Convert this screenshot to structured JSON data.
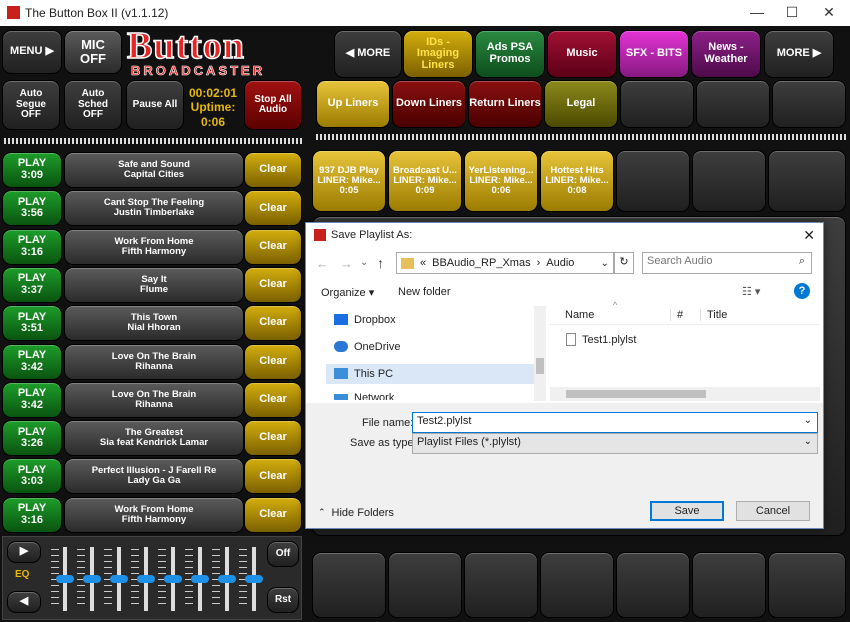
{
  "window": {
    "title": "The Button Box II (v1.1.12)",
    "minimize": "—",
    "maximize": "☐",
    "close": "✕"
  },
  "left_top": {
    "menu": "MENU ▶",
    "mic_line1": "MIC",
    "mic_line2": "OFF",
    "logo_line1": "Button",
    "logo_line2": "BROADCASTER",
    "auto_segue_1": "Auto",
    "auto_segue_2": "Segue",
    "auto_segue_3": "OFF",
    "auto_sched_1": "Auto",
    "auto_sched_2": "Sched",
    "auto_sched_3": "OFF",
    "pause_all": "Pause All",
    "timer": "00:02:01",
    "uptime_label": "Uptime:",
    "uptime": "0:06",
    "stop_all_1": "Stop All",
    "stop_all_2": "Audio"
  },
  "category_bar": {
    "more_left": "◀ MORE",
    "ids_1": "IDs -",
    "ids_2": "Imaging",
    "ids_3": "Liners",
    "ads_1": "Ads  PSA",
    "ads_2": "Promos",
    "music": "Music",
    "sfx": "SFX - BITS",
    "news_1": "News -",
    "news_2": "Weather",
    "more_right": "MORE ▶"
  },
  "sub_tabs": {
    "up": "Up Liners",
    "down": "Down Liners",
    "return": "Return Liners",
    "legal": "Legal"
  },
  "liners": [
    {
      "l1": "937 DJB Play",
      "l2": "LINER: Mike...",
      "l3": "0:05"
    },
    {
      "l1": "Broadcast U...",
      "l2": "LINER: Mike...",
      "l3": "0:09"
    },
    {
      "l1": "YerListening...",
      "l2": "LINER: Mike...",
      "l3": "0:06"
    },
    {
      "l1": "Hottest Hits",
      "l2": "LINER: Mike...",
      "l3": "0:08"
    }
  ],
  "playlist": [
    {
      "play": "PLAY",
      "dur": "3:09",
      "song": "Safe and Sound",
      "artist": "Capital Cities",
      "clear": "Clear"
    },
    {
      "play": "PLAY",
      "dur": "3:56",
      "song": "Cant Stop The Feeling",
      "artist": "Justin Timberlake",
      "clear": "Clear"
    },
    {
      "play": "PLAY",
      "dur": "3:16",
      "song": "Work From Home",
      "artist": "Fifth Harmony",
      "clear": "Clear"
    },
    {
      "play": "PLAY",
      "dur": "3:37",
      "song": "Say It",
      "artist": "Flume",
      "clear": "Clear"
    },
    {
      "play": "PLAY",
      "dur": "3:51",
      "song": "This Town",
      "artist": "Nial Hhoran",
      "clear": "Clear"
    },
    {
      "play": "PLAY",
      "dur": "3:42",
      "song": "Love On The Brain",
      "artist": "Rihanna",
      "clear": "Clear"
    },
    {
      "play": "PLAY",
      "dur": "3:42",
      "song": "Love On The Brain",
      "artist": "Rihanna",
      "clear": "Clear"
    },
    {
      "play": "PLAY",
      "dur": "3:26",
      "song": "The Greatest",
      "artist": "Sia feat Kendrick Lamar",
      "clear": "Clear"
    },
    {
      "play": "PLAY",
      "dur": "3:03",
      "song": "Perfect Illusion - J Farell Re",
      "artist": "Lady Ga Ga",
      "clear": "Clear"
    },
    {
      "play": "PLAY",
      "dur": "3:16",
      "song": "Work From Home",
      "artist": "Fifth Harmony",
      "clear": "Clear"
    }
  ],
  "eq": {
    "label": "EQ",
    "off": "Off",
    "rst": "Rst",
    "next": "▶",
    "prev": "◀"
  },
  "dialog": {
    "title": "Save Playlist As:",
    "path_root": "«",
    "path_1": "BBAudio_RP_Xmas",
    "path_sep": "›",
    "path_2": "Audio",
    "search_placeholder": "Search Audio",
    "organize": "Organize ▾",
    "new_folder": "New folder",
    "col_name": "Name",
    "col_num": "#",
    "col_title": "Title",
    "file_1": "Test1.plylst",
    "nav": [
      "Dropbox",
      "OneDrive",
      "This PC",
      "Network"
    ],
    "file_name_label": "File name:",
    "file_name": "Test2.plylst",
    "type_label": "Save as type:",
    "type_value": "Playlist Files (*.plylst)",
    "hide_folders": "Hide Folders",
    "save": "Save",
    "cancel": "Cancel",
    "close": "✕",
    "help": "?"
  },
  "colors": {
    "accent_gold": "#d3ae0d",
    "play_green": "#1d9d2a",
    "logo_red": "#e82424",
    "dialog_blue": "#0078d7"
  }
}
